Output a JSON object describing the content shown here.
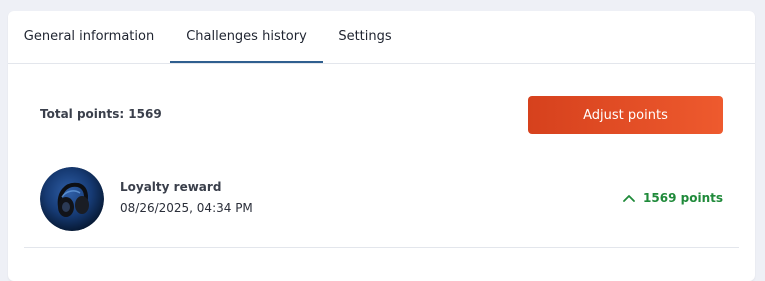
{
  "tabs": [
    {
      "label": "General information",
      "active": false
    },
    {
      "label": "Challenges history",
      "active": true
    },
    {
      "label": "Settings",
      "active": false
    }
  ],
  "summary": {
    "total_label": "Total points: 1569",
    "adjust_button": "Adjust points"
  },
  "history": [
    {
      "title": "Loyalty reward",
      "datetime": "08/26/2025, 04:34 PM",
      "points": "1569 points",
      "direction": "up",
      "icon": "chevron-up-icon"
    }
  ],
  "colors": {
    "accent_button": "#e4512a",
    "positive": "#1f8a3a",
    "tab_underline": "#2f5f8f"
  }
}
